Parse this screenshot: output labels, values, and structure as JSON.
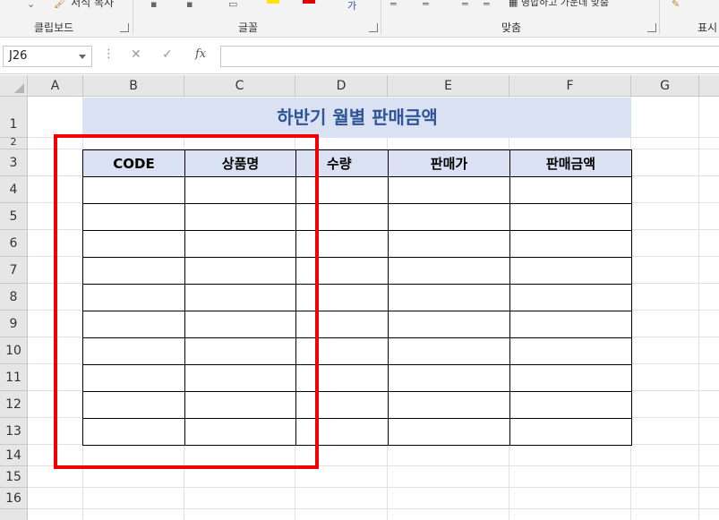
{
  "ribbon": {
    "format_painter": "서식 복사",
    "groups": [
      "클립보드",
      "글꼴",
      "맞춤",
      "표시"
    ],
    "merge_label": "병합하고 가운데 맞춤"
  },
  "formula_bar": {
    "name_box": "J26",
    "cancel_icon": "x-icon",
    "enter_icon": "check-icon",
    "function_icon": "fx",
    "formula": ""
  },
  "sheet": {
    "columns": [
      "A",
      "B",
      "C",
      "D",
      "E",
      "F",
      "G"
    ],
    "rows": [
      "1",
      "2",
      "3",
      "4",
      "5",
      "6",
      "7",
      "8",
      "9",
      "10",
      "11",
      "12",
      "13",
      "14",
      "15",
      "16"
    ],
    "title": "하반기 월별 판매금액",
    "table_headers": [
      "CODE",
      "상품명",
      "수량",
      "판매가",
      "판매금액"
    ]
  },
  "colors": {
    "header_fill": "#d9e1f2",
    "title_text": "#2f5597",
    "highlight": "#f00000"
  }
}
